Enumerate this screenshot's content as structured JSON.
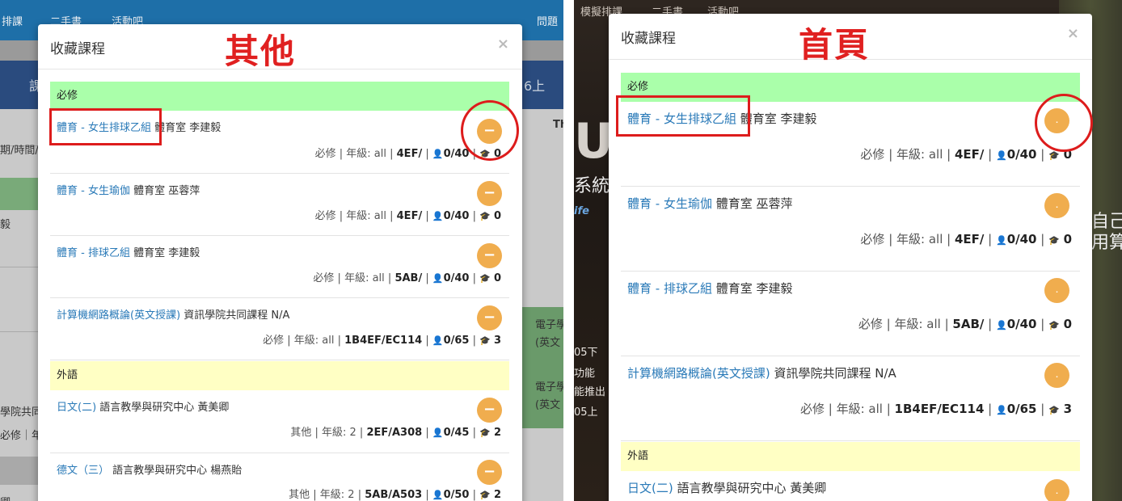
{
  "left": {
    "nav": {
      "items": [
        "排課",
        "二手書",
        "活動吧"
      ],
      "right_item": "問題"
    },
    "bg_texts": [
      "課",
      "6上",
      "Th",
      "期/時間/",
      "毅",
      "電子學",
      "(英文",
      "電子學",
      "(英文",
      "學院共同",
      "必修｜年",
      "卿"
    ],
    "modal": {
      "title": "收藏課程",
      "close": "×",
      "big_label": "其他",
      "sections": [
        {
          "name": "必修",
          "courses": [
            {
              "link": "體育 - 女生排球乙組",
              "rest": " 體育室 李建毅",
              "type": "必修",
              "grade": "年級: all",
              "code": "4EF/",
              "enroll": "0/40",
              "fav": "0"
            },
            {
              "link": "體育 - 女生瑜伽",
              "rest": " 體育室 巫蓉萍",
              "type": "必修",
              "grade": "年級: all",
              "code": "4EF/",
              "enroll": "0/40",
              "fav": "0"
            },
            {
              "link": "體育 - 排球乙組",
              "rest": " 體育室 李建毅",
              "type": "必修",
              "grade": "年級: all",
              "code": "5AB/",
              "enroll": "0/40",
              "fav": "0"
            },
            {
              "link": "計算機網路概論(英文授課)",
              "rest": " 資訊學院共同課程 N/A",
              "type": "必修",
              "grade": "年級: all",
              "code": "1B4EF/EC114",
              "enroll": "0/65",
              "fav": "3"
            }
          ]
        },
        {
          "name": "外語",
          "courses": [
            {
              "link": "日文(二)",
              "rest": " 語言教學與研究中心 黃美卿",
              "type": "其他",
              "grade": "年級: 2",
              "code": "2EF/A308",
              "enroll": "0/45",
              "fav": "2"
            },
            {
              "link": "德文（三）",
              "rest": " 語言教學與研究中心 楊燕貽",
              "type": "其他",
              "grade": "年級: 2",
              "code": "5AB/A503",
              "enroll": "0/50",
              "fav": "2"
            }
          ]
        }
      ]
    }
  },
  "right": {
    "nav": {
      "items": [
        "模擬排課",
        "二手書",
        "活動吧"
      ]
    },
    "bg_texts": [
      "U+",
      "系統",
      "ife",
      "自己",
      "用算",
      "05下",
      "功能",
      "能推出",
      "05上"
    ],
    "modal": {
      "title": "收藏課程",
      "close": "×",
      "big_label": "首頁",
      "sections": [
        {
          "name": "必修",
          "courses": [
            {
              "link": "體育 - 女生排球乙組",
              "rest": " 體育室 李建毅",
              "type": "必修",
              "grade": "年級: all",
              "code": "4EF/",
              "enroll": "0/40",
              "fav": "0"
            },
            {
              "link": "體育 - 女生瑜伽",
              "rest": " 體育室 巫蓉萍",
              "type": "必修",
              "grade": "年級: all",
              "code": "4EF/",
              "enroll": "0/40",
              "fav": "0"
            },
            {
              "link": "體育 - 排球乙組",
              "rest": " 體育室 李建毅",
              "type": "必修",
              "grade": "年級: all",
              "code": "5AB/",
              "enroll": "0/40",
              "fav": "0"
            },
            {
              "link": "計算機網路概論(英文授課)",
              "rest": " 資訊學院共同課程 N/A",
              "type": "必修",
              "grade": "年級: all",
              "code": "1B4EF/EC114",
              "enroll": "0/65",
              "fav": "3"
            }
          ]
        },
        {
          "name": "外語",
          "courses": [
            {
              "link": "日文(二)",
              "rest": " 語言教學與研究中心 黃美卿"
            }
          ]
        }
      ]
    }
  },
  "icons": {
    "user": "user-icon",
    "cap": "graduation-cap-icon",
    "minus": "minus-icon"
  },
  "colors": {
    "fav_button": "#f0ad4e",
    "link": "#2a7ab8",
    "section_required": "#aaffaa",
    "section_foreign": "#ffffc4",
    "annotation": "#dd1c1c"
  }
}
